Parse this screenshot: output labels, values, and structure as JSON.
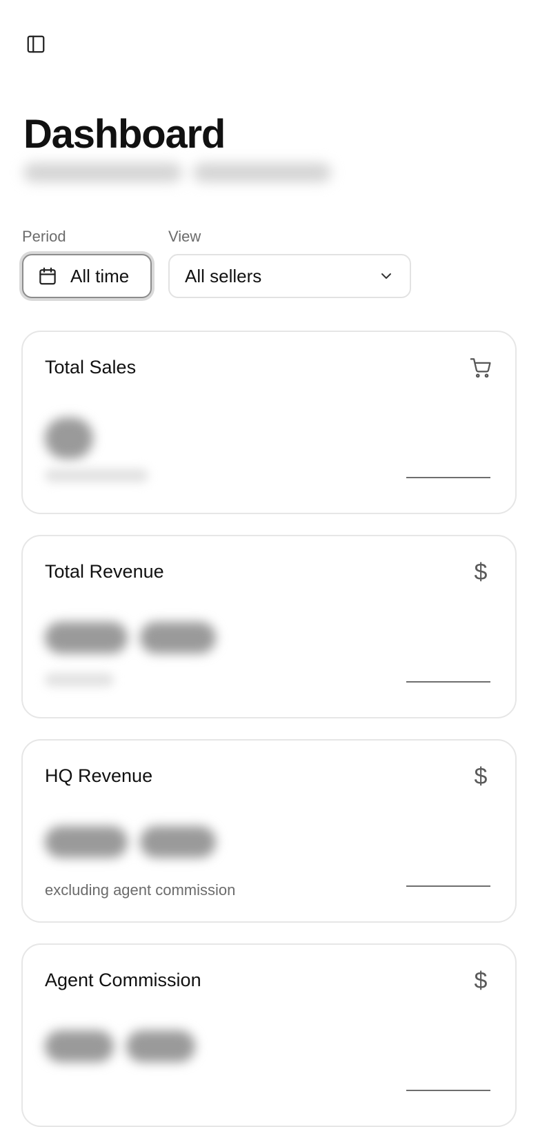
{
  "header": {
    "title": "Dashboard",
    "sidebar_toggle_icon": "sidebar-panel-icon"
  },
  "filters": {
    "period": {
      "label": "Period",
      "value": "All time",
      "icon": "calendar-icon"
    },
    "view": {
      "label": "View",
      "value": "All sellers",
      "icon": "chevron-down-icon"
    }
  },
  "cards": [
    {
      "title": "Total Sales",
      "icon": "cart-icon",
      "note": ""
    },
    {
      "title": "Total Revenue",
      "icon": "dollar-icon",
      "note": ""
    },
    {
      "title": "HQ Revenue",
      "icon": "dollar-icon",
      "note": "excluding agent commission"
    },
    {
      "title": "Agent Commission",
      "icon": "dollar-icon",
      "note": ""
    }
  ],
  "glyphs": {
    "dollar": "$"
  },
  "colors": {
    "text": "#111111",
    "muted": "#6b6b6b",
    "border": "#e6e6e6",
    "focus_ring": "#d9d9d9"
  }
}
